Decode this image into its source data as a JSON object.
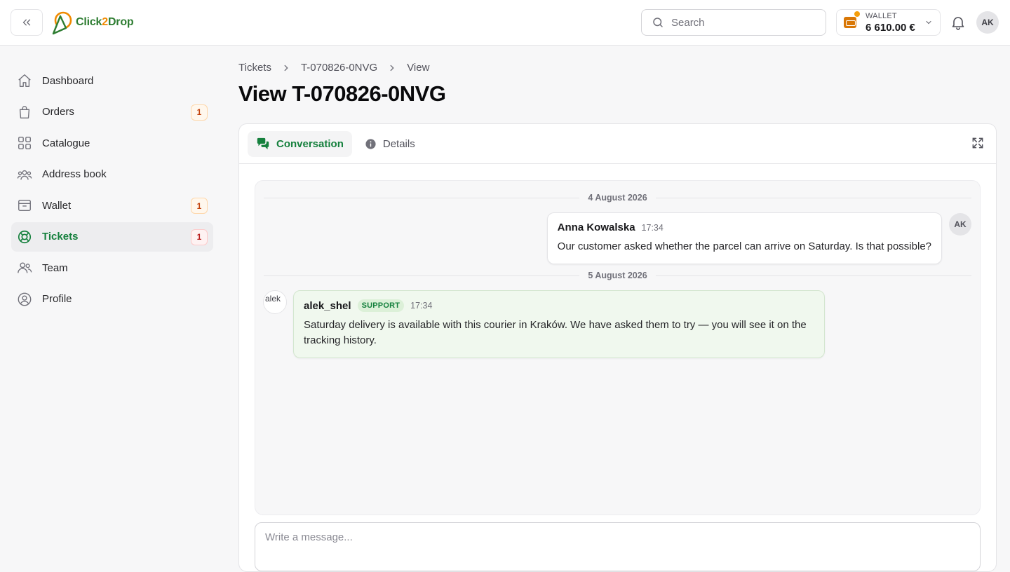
{
  "app": {
    "logo_text_a": "Click",
    "logo_text_b": "2",
    "logo_text_c": "Drop"
  },
  "header": {
    "search_placeholder": "Search",
    "wallet_label": "WALLET",
    "wallet_amount": "6 610.00 €",
    "user_initials": "AK"
  },
  "sidebar": {
    "items": [
      {
        "label": "Dashboard",
        "icon": "home-icon"
      },
      {
        "label": "Orders",
        "icon": "shopping-bag-icon",
        "badge": "1"
      },
      {
        "label": "Catalogue",
        "icon": "grid-icon"
      },
      {
        "label": "Address book",
        "icon": "users-group-icon"
      },
      {
        "label": "Wallet",
        "icon": "archive-box-icon",
        "badge": "1"
      },
      {
        "label": "Tickets",
        "icon": "lifebuoy-icon",
        "badge": "1",
        "active": true
      },
      {
        "label": "Team",
        "icon": "users-icon"
      },
      {
        "label": "Profile",
        "icon": "user-circle-icon"
      }
    ]
  },
  "breadcrumb": [
    "Tickets",
    "T-070826-0NVG",
    "View"
  ],
  "page_title": "View T-070826-0NVG",
  "tabs": [
    {
      "label": "Conversation",
      "icon": "chat-bubbles-icon",
      "active": true
    },
    {
      "label": "Details",
      "icon": "info-circle-icon"
    }
  ],
  "conversation": {
    "days": [
      "4 August 2026",
      "5 August 2026"
    ],
    "messages": [
      {
        "author": "Anna Kowalska",
        "time": "17:34",
        "text": "Our customer asked whether the parcel can arrive on Saturday. Is that possible?",
        "initials": "AK"
      },
      {
        "author": "alek_shel",
        "role": "SUPPORT",
        "time": "17:34",
        "text": "Saturday delivery is available with this courier in Kraków. We have asked them to try — you will see it on the tracking history.",
        "avatar_alt": "alek"
      }
    ]
  },
  "composer": {
    "placeholder": "Write a message..."
  },
  "colors": {
    "brand_green": "#15803d",
    "brand_orange": "#f08a00",
    "badge_orange": "#c2410c",
    "badge_red": "#b91c1c"
  }
}
